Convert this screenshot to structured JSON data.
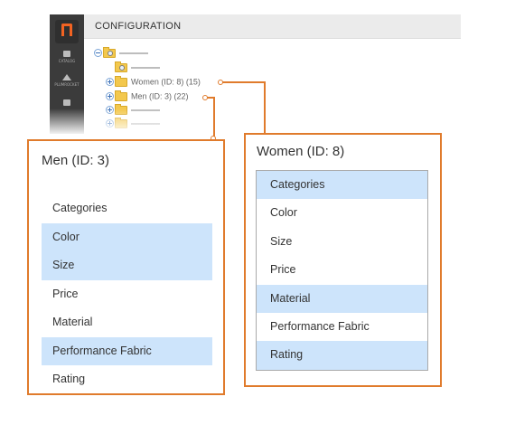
{
  "admin": {
    "title": "CONFIGURATION",
    "nav": [
      {
        "label": "CATALOG",
        "icon": "cube-icon"
      },
      {
        "label": "PLUMROCKET",
        "icon": "triangle-icon"
      },
      {
        "label": "",
        "icon": "page-icon"
      }
    ]
  },
  "tree": {
    "women_label": "Women (ID: 8) (15)",
    "men_label": "Men (ID: 3) (22)"
  },
  "men_panel": {
    "title": "Men (ID: 3)",
    "items": [
      {
        "label": "Categories",
        "selected": false
      },
      {
        "label": "Color",
        "selected": true
      },
      {
        "label": "Size",
        "selected": true
      },
      {
        "label": "Price",
        "selected": false
      },
      {
        "label": "Material",
        "selected": false
      },
      {
        "label": "Performance Fabric",
        "selected": true
      },
      {
        "label": "Rating",
        "selected": false
      }
    ]
  },
  "women_panel": {
    "title": "Women (ID: 8)",
    "items": [
      {
        "label": "Categories",
        "selected": true
      },
      {
        "label": "Color",
        "selected": false
      },
      {
        "label": "Size",
        "selected": false
      },
      {
        "label": "Price",
        "selected": false
      },
      {
        "label": "Material",
        "selected": true
      },
      {
        "label": "Performance Fabric",
        "selected": false
      },
      {
        "label": "Rating",
        "selected": true
      }
    ]
  },
  "colors": {
    "accent": "#e07b2c",
    "selection": "#cde4fb",
    "sidebar": "#3b3b3b"
  }
}
